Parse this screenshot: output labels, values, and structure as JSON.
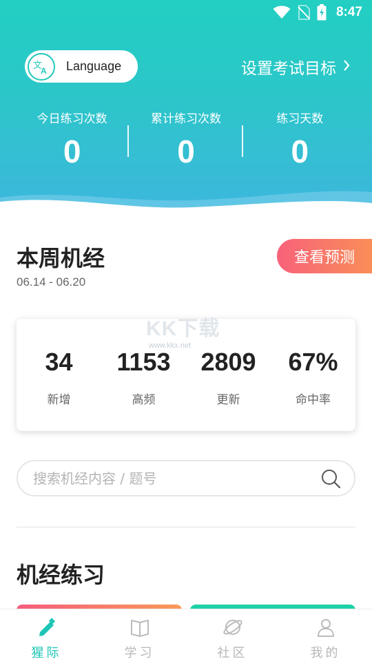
{
  "status_bar": {
    "time": "8:47",
    "icons": [
      "wifi-icon",
      "no-sim-icon",
      "battery-charging-icon"
    ]
  },
  "header": {
    "language_label": "Language",
    "language_icon": "translate-icon",
    "set_goal_label": "设置考试目标",
    "stats": [
      {
        "label": "今日练习次数",
        "value": "0"
      },
      {
        "label": "累计练习次数",
        "value": "0"
      },
      {
        "label": "练习天数",
        "value": "0"
      }
    ]
  },
  "weekly": {
    "title": "本周机经",
    "date_range": "06.14 - 06.20",
    "predict_button": "查看预测",
    "stats": [
      {
        "value": "34",
        "label": "新增"
      },
      {
        "value": "1153",
        "label": "高频"
      },
      {
        "value": "2809",
        "label": "更新"
      },
      {
        "value": "67%",
        "label": "命中率"
      }
    ]
  },
  "watermark": {
    "main": "KK下载",
    "url": "www.kkx.net"
  },
  "search": {
    "placeholder": "搜索机经内容 / 题号"
  },
  "practice": {
    "title": "机经练习"
  },
  "bottom_nav": {
    "items": [
      {
        "label": "猩际",
        "icon": "pencil-icon",
        "active": true
      },
      {
        "label": "学习",
        "icon": "book-icon",
        "active": false
      },
      {
        "label": "社区",
        "icon": "planet-icon",
        "active": false
      },
      {
        "label": "我的",
        "icon": "user-icon",
        "active": false
      }
    ]
  },
  "colors": {
    "accent": "#1ec5b6",
    "header_top": "#22cfc2",
    "header_bottom": "#3db7dd",
    "predict_start": "#f8627a",
    "predict_end": "#f98e58"
  }
}
